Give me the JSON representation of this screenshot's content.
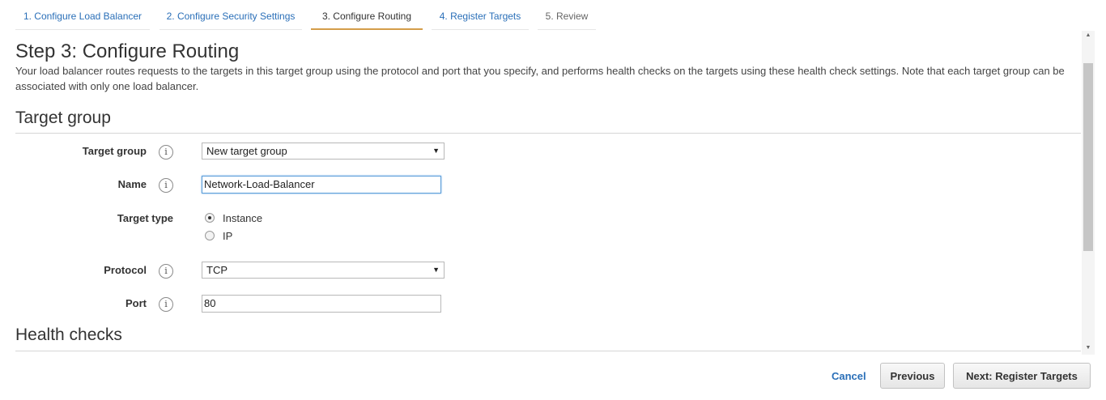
{
  "tabs": [
    {
      "label": "1. Configure Load Balancer",
      "state": "link"
    },
    {
      "label": "2. Configure Security Settings",
      "state": "link"
    },
    {
      "label": "3. Configure Routing",
      "state": "active"
    },
    {
      "label": "4. Register Targets",
      "state": "link"
    },
    {
      "label": "5. Review",
      "state": "disabled"
    }
  ],
  "page": {
    "title": "Step 3: Configure Routing",
    "intro": "Your load balancer routes requests to the targets in this target group using the protocol and port that you specify, and performs health checks on the targets using these health check settings. Note that each target group can be associated with only one load balancer."
  },
  "target_group_section": {
    "title": "Target group",
    "fields": {
      "target_group": {
        "label": "Target group",
        "value": "New target group"
      },
      "name": {
        "label": "Name",
        "value": "Network-Load-Balancer"
      },
      "target_type": {
        "label": "Target type",
        "options": [
          "Instance",
          "IP"
        ],
        "selected": "Instance"
      },
      "protocol": {
        "label": "Protocol",
        "value": "TCP"
      },
      "port": {
        "label": "Port",
        "value": "80"
      }
    }
  },
  "health_checks_section": {
    "title": "Health checks"
  },
  "icons": {
    "info": "i",
    "caret": "▼",
    "scroll_up": "▲",
    "scroll_down": "▼"
  },
  "footer": {
    "cancel": "Cancel",
    "previous": "Previous",
    "next": "Next: Register Targets"
  },
  "colors": {
    "accent": "#d49d49",
    "link": "#2a6fb8",
    "focus": "#5b9dd9"
  }
}
